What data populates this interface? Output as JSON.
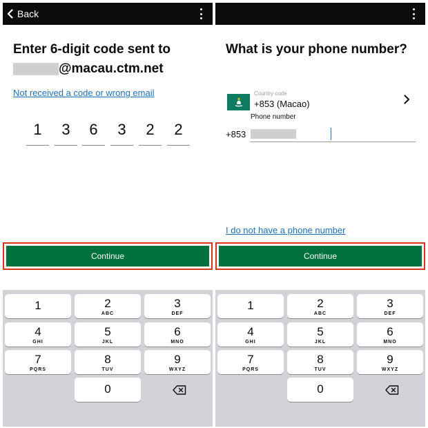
{
  "left": {
    "back_label": "Back",
    "heading_line1": "Enter 6-digit code sent to",
    "email_domain": "@macau.ctm.net",
    "resend_link": "Not received a code or wrong email",
    "code_digits": [
      "1",
      "3",
      "6",
      "3",
      "2",
      "2"
    ],
    "continue_label": "Continue"
  },
  "right": {
    "heading": "What is your phone number?",
    "country_code_label": "Country code",
    "country_code_value": "+853 (Macao)",
    "phone_number_label": "Phone number",
    "phone_prefix": "+853",
    "no_phone_link": "I do not have a phone number",
    "continue_label": "Continue"
  },
  "keypad": [
    {
      "num": "1",
      "letters": ""
    },
    {
      "num": "2",
      "letters": "ABC"
    },
    {
      "num": "3",
      "letters": "DEF"
    },
    {
      "num": "4",
      "letters": "GHI"
    },
    {
      "num": "5",
      "letters": "JKL"
    },
    {
      "num": "6",
      "letters": "MNO"
    },
    {
      "num": "7",
      "letters": "PQRS"
    },
    {
      "num": "8",
      "letters": "TUV"
    },
    {
      "num": "9",
      "letters": "WXYZ"
    },
    {
      "num": "0",
      "letters": ""
    }
  ],
  "icons": {
    "back": "chevron-left-icon",
    "menu": "more-vertical-icon",
    "country_select": "chevron-right-icon",
    "delete": "backspace-icon",
    "flag": "macao-flag-icon"
  },
  "colors": {
    "top_bar": "#0b0c0c",
    "button_green": "#00703c",
    "link_blue": "#1d70b8",
    "highlight_red": "#d4351c",
    "keypad_background": "#d1d3d9"
  }
}
